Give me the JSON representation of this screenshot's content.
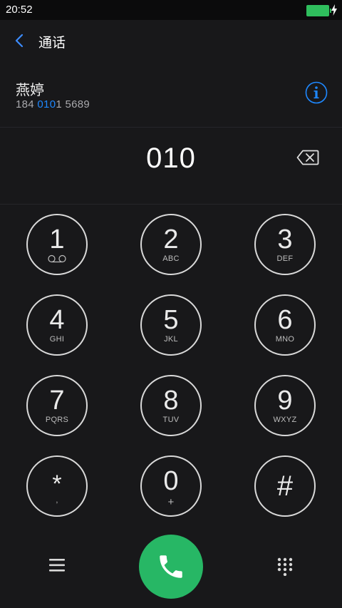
{
  "status_bar": {
    "time": "20:52"
  },
  "header": {
    "title": "通话"
  },
  "contact": {
    "name": "燕婷",
    "number_prefix": "184 ",
    "number_match": "010",
    "number_suffix": "1 5689"
  },
  "dialer": {
    "input": "010"
  },
  "keypad": {
    "keys": [
      {
        "digit": "1",
        "letters": ""
      },
      {
        "digit": "2",
        "letters": "ABC"
      },
      {
        "digit": "3",
        "letters": "DEF"
      },
      {
        "digit": "4",
        "letters": "GHI"
      },
      {
        "digit": "5",
        "letters": "JKL"
      },
      {
        "digit": "6",
        "letters": "MNO"
      },
      {
        "digit": "7",
        "letters": "PQRS"
      },
      {
        "digit": "8",
        "letters": "TUV"
      },
      {
        "digit": "9",
        "letters": "WXYZ"
      },
      {
        "digit": "*",
        "letters": ","
      },
      {
        "digit": "0",
        "letters": "+"
      },
      {
        "digit": "#",
        "letters": ""
      }
    ]
  },
  "colors": {
    "accent_blue": "#1e88ff",
    "call_green": "#27b765",
    "battery_green": "#2fbe5d"
  }
}
